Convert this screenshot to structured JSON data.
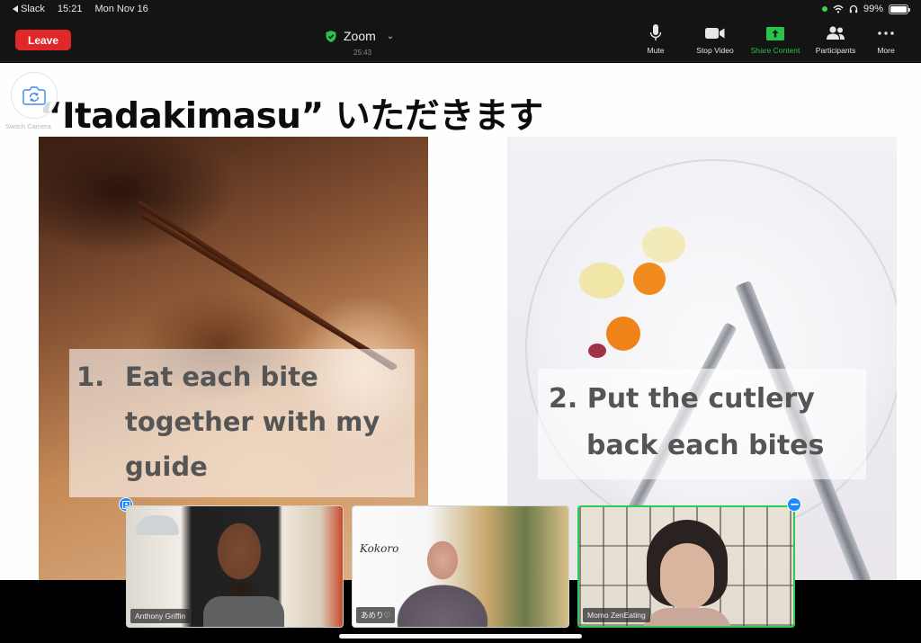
{
  "status_bar": {
    "back_app": "Slack",
    "time": "15:21",
    "date": "Mon Nov 16",
    "battery_percent": "99%",
    "battery_level": 0.99
  },
  "toolbar": {
    "leave_label": "Leave",
    "meeting_title": "Zoom",
    "meeting_timer": "25:43",
    "actions": [
      {
        "label": "Mute",
        "icon": "microphone-icon"
      },
      {
        "label": "Stop Video",
        "icon": "video-camera-icon"
      },
      {
        "label": "Share Content",
        "icon": "share-arrow-icon"
      },
      {
        "label": "Participants",
        "icon": "participants-icon"
      },
      {
        "label": "More",
        "icon": "more-dots-icon"
      }
    ],
    "accent_color": "#29c24b",
    "leave_color": "#e02828"
  },
  "switch_camera": {
    "label": "Switch Camera"
  },
  "slide": {
    "title": "“Itadakimasu” いただきます",
    "captions": [
      {
        "number": "1.",
        "text": "Eat each bite together with my guide"
      },
      {
        "line1": "2. Put the cutlery",
        "line2": "back each bites"
      }
    ]
  },
  "participants": [
    {
      "name": "Anthony Griffin",
      "active_speaker": false,
      "badge": "pin"
    },
    {
      "name": "あめり♡",
      "active_speaker": false,
      "poster_text": "Kokoro"
    },
    {
      "name": "Momo ZenEating",
      "active_speaker": true,
      "badge": "minimize"
    }
  ]
}
